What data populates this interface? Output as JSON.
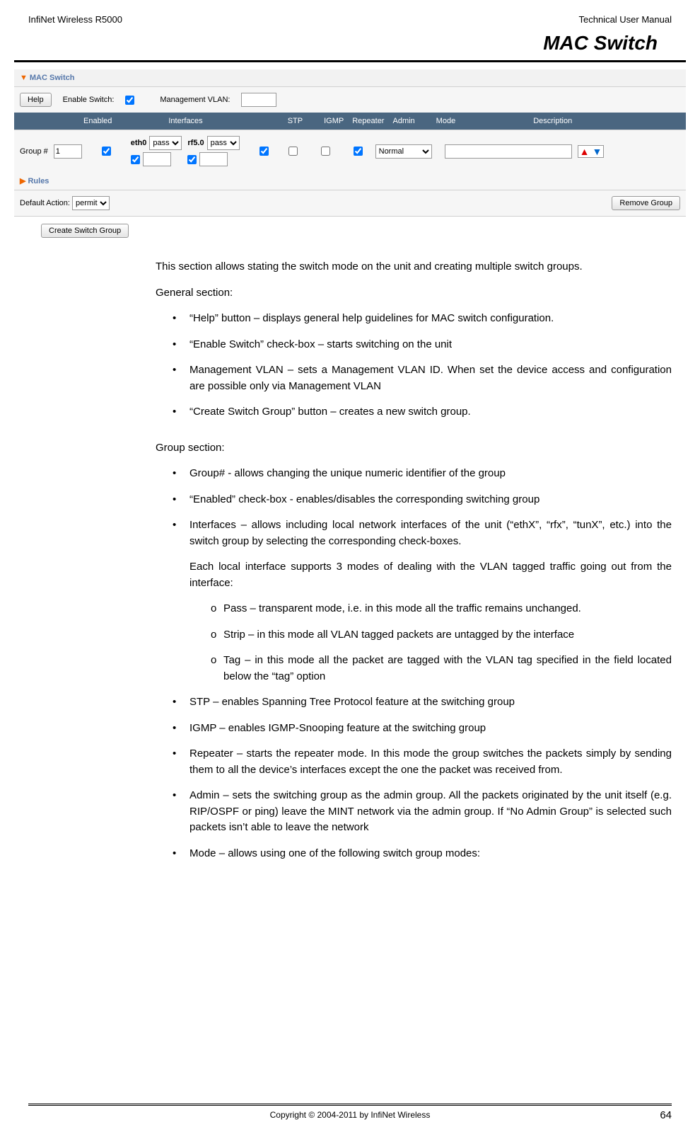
{
  "header": {
    "left": "InfiNet Wireless R5000",
    "right": "Technical User Manual"
  },
  "section_title": "MAC Switch",
  "screenshot": {
    "panel_title": "MAC Switch",
    "help_button": "Help",
    "enable_switch_label": "Enable Switch:",
    "mgmt_vlan_label": "Management VLAN:",
    "columns": {
      "enabled": "Enabled",
      "interfaces": "Interfaces",
      "stp": "STP",
      "igmp": "IGMP",
      "repeater": "Repeater",
      "admin": "Admin",
      "mode": "Mode",
      "description": "Description"
    },
    "group_label": "Group #",
    "group_num": "1",
    "iface1": "eth0",
    "iface2": "rf5.0",
    "pass_option": "pass",
    "mode_option": "Normal",
    "rules_label": "Rules",
    "default_action_label": "Default Action:",
    "default_action_value": "permit",
    "remove_group_button": "Remove Group",
    "create_group_button": "Create Switch Group"
  },
  "text": {
    "intro": "This section allows stating the switch mode on the unit and creating multiple switch groups.",
    "general_label": "General section:",
    "general_items": {
      "help": "“Help” button – displays general help guidelines for MAC switch configuration.",
      "enable": "“Enable Switch” check-box – starts switching on the unit",
      "mgmt": "Management VLAN – sets a Management VLAN ID. When set the device access and configuration are possible only via Management VLAN",
      "create": "“Create Switch Group” button – creates a new switch group."
    },
    "group_label": "Group section:",
    "group_items": {
      "groupnum": "Group# - allows changing the unique numeric identifier of the group",
      "enabled": "“Enabled” check-box  - enables/disables the corresponding switching group",
      "interfaces": "Interfaces – allows including local network interfaces of the unit (“ethX”, “rfx”, “tunX”, etc.) into the switch group by selecting the corresponding check-boxes.",
      "interfaces_sub": "Each local interface supports 3 modes of dealing with the VLAN tagged traffic going out from the interface:",
      "pass": "Pass – transparent mode, i.e. in this mode all the traffic remains unchanged.",
      "strip": "Strip – in this mode all VLAN tagged packets are untagged by the interface",
      "tag": "Tag – in this mode all the packet are tagged with the VLAN tag specified in the field located below the “tag” option",
      "stp": "STP – enables Spanning Tree Protocol feature at the switching group",
      "igmp": "IGMP – enables IGMP-Snooping feature at the switching group",
      "repeater": "Repeater – starts the repeater mode. In this mode the group switches the packets simply by sending them to all the device’s interfaces except the one the packet was received from.",
      "admin": "Admin – sets the switching group as the admin group. All the packets originated by the unit itself (e.g. RIP/OSPF or ping) leave the MINT network via the admin group. If “No Admin Group” is selected such packets isn’t able to leave the network",
      "mode": "Mode – allows using one of the following switch group modes:"
    }
  },
  "footer": {
    "copyright": "Copyright © 2004-2011 by InfiNet Wireless",
    "page": "64"
  }
}
